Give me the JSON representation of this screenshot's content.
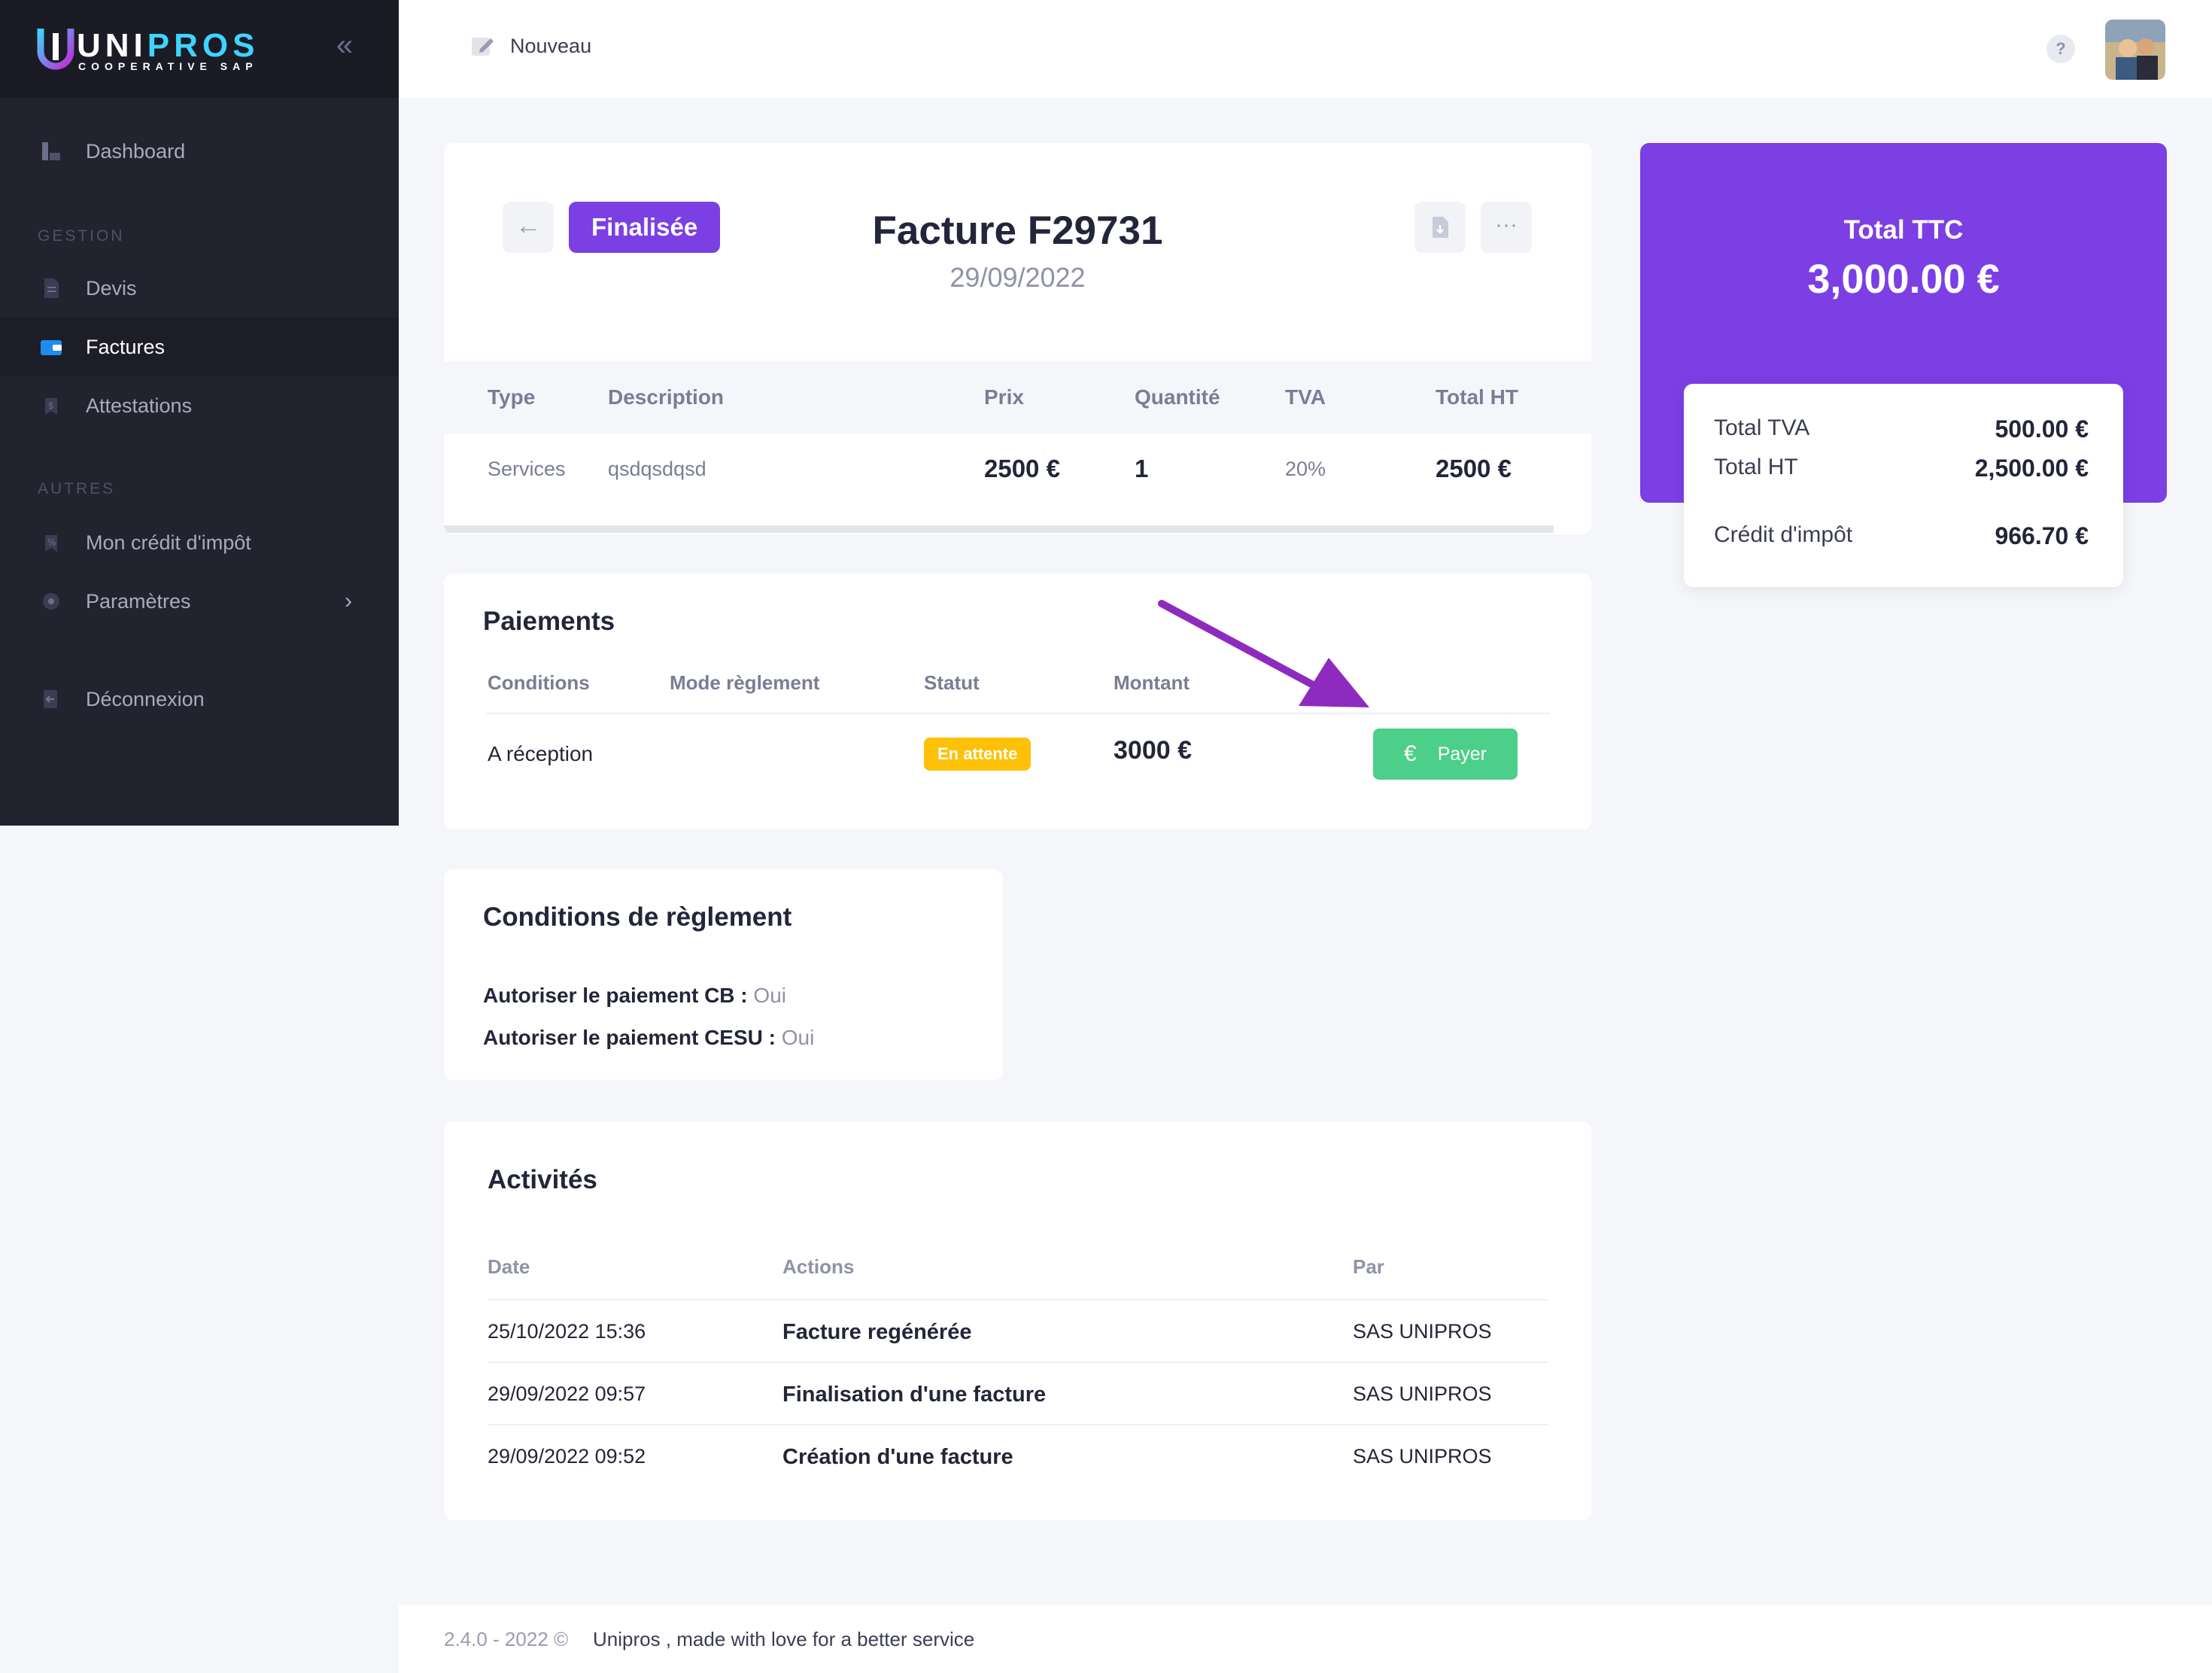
{
  "brand": {
    "name_part1": "UNI",
    "name_part2": "PROS",
    "tagline": "COOPERATIVE SAP",
    "accent": "#3fd3ff"
  },
  "sidebar": {
    "dashboard": "Dashboard",
    "section_gestion": "GESTION",
    "devis": "Devis",
    "factures": "Factures",
    "attestations": "Attestations",
    "section_autres": "AUTRES",
    "credit": "Mon crédit d'impôt",
    "parametres": "Paramètres",
    "deconnexion": "Déconnexion"
  },
  "header": {
    "new_label": "Nouveau",
    "help": "?"
  },
  "invoice": {
    "status": "Finalisée",
    "title": "Facture F29731",
    "date": "29/09/2022",
    "columns": {
      "type": "Type",
      "description": "Description",
      "prix": "Prix",
      "quantite": "Quantité",
      "tva": "TVA",
      "total_ht": "Total HT"
    },
    "row": {
      "type": "Services",
      "description": "qsdqsdqsd",
      "prix": "2500 €",
      "quantite": "1",
      "tva": "20%",
      "total_ht": "2500 €"
    }
  },
  "payments": {
    "title": "Paiements",
    "columns": {
      "conditions": "Conditions",
      "mode": "Mode règlement",
      "statut": "Statut",
      "montant": "Montant"
    },
    "row": {
      "conditions": "A réception",
      "statut": "En attente",
      "montant": "3000 €"
    },
    "pay_label": "Payer",
    "pay_icon": "€"
  },
  "conditions": {
    "title": "Conditions de règlement",
    "cb_label": "Autoriser le paiement CB :",
    "cb_value": "Oui",
    "cesu_label": "Autoriser le paiement CESU :",
    "cesu_value": "Oui"
  },
  "activities": {
    "title": "Activités",
    "columns": {
      "date": "Date",
      "actions": "Actions",
      "par": "Par"
    },
    "rows": [
      {
        "date": "25/10/2022 15:36",
        "action": "Facture regénérée",
        "par": "SAS UNIPROS"
      },
      {
        "date": "29/09/2022 09:57",
        "action": "Finalisation d'une facture",
        "par": "SAS UNIPROS"
      },
      {
        "date": "29/09/2022 09:52",
        "action": "Création d'une facture",
        "par": "SAS UNIPROS"
      }
    ]
  },
  "totals": {
    "ttc_label": "Total TTC",
    "ttc_value": "3,000.00 €",
    "tva_label": "Total TVA",
    "tva_value": "500.00 €",
    "ht_label": "Total HT",
    "ht_value": "2,500.00 €",
    "credit_label": "Crédit d'impôt",
    "credit_value": "966.70 €"
  },
  "footer": {
    "version": "2.4.0 - 2022 ©",
    "text": "Unipros , made with love for a better service"
  },
  "colors": {
    "primary": "#7b3fe4",
    "success": "#4ccf88",
    "warning": "#ffc107",
    "sidebar": "#22232f",
    "annotation_arrow": "#8e2bbf"
  }
}
